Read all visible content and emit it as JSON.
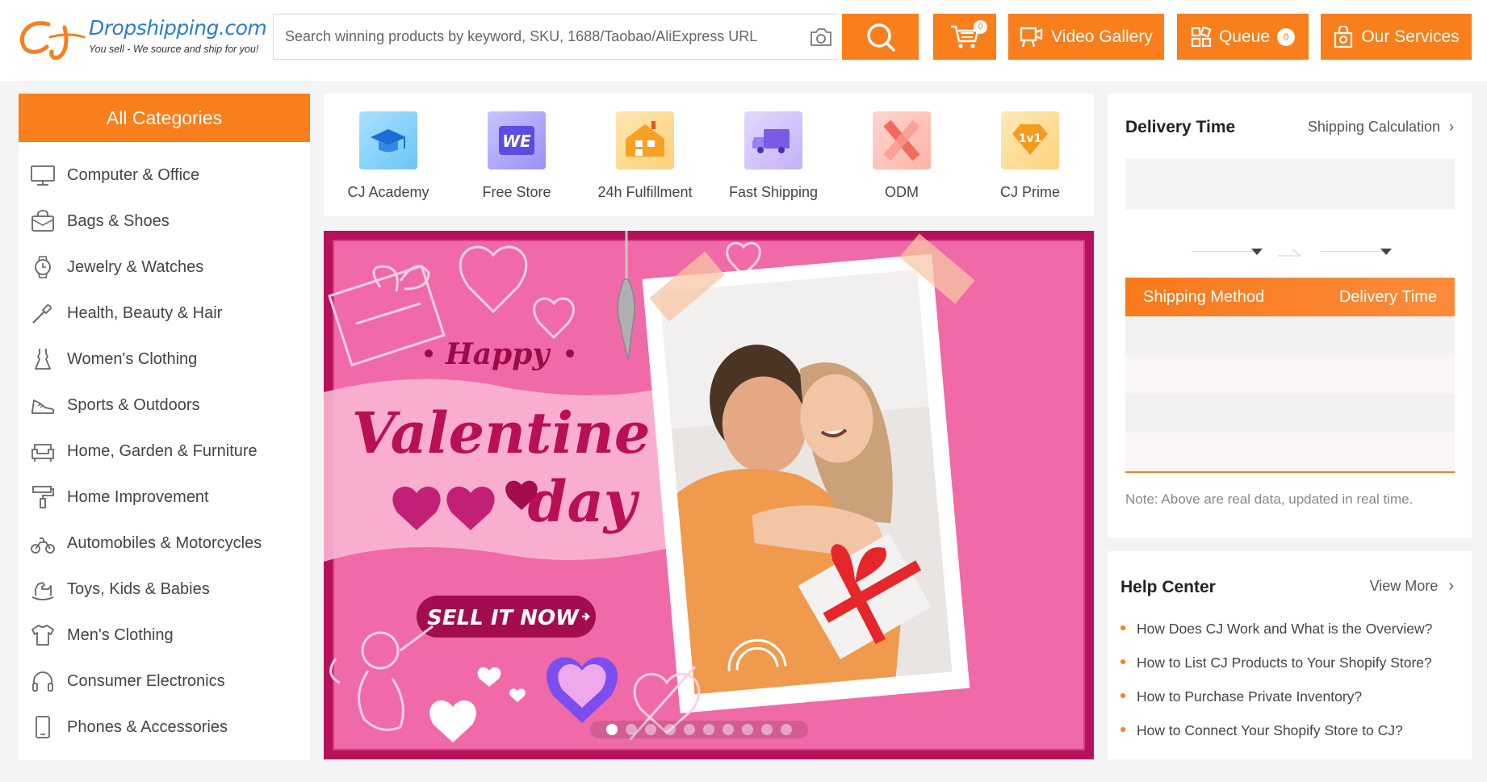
{
  "header": {
    "logo_text": "Dropshipping.com",
    "logo_tagline": "You sell - We source and ship for you!",
    "search_placeholder": "Search winning products by keyword, SKU, 1688/Taobao/AliExpress URL",
    "cart_count": "0",
    "video_gallery_label": "Video Gallery",
    "queue_label": "Queue",
    "queue_count": "0",
    "our_services_label": "Our Services"
  },
  "categories": {
    "title": "All Categories",
    "items": [
      {
        "label": "Computer & Office",
        "icon": "monitor-icon"
      },
      {
        "label": "Bags & Shoes",
        "icon": "bag-icon"
      },
      {
        "label": "Jewelry & Watches",
        "icon": "watch-icon"
      },
      {
        "label": "Health, Beauty & Hair",
        "icon": "brush-icon"
      },
      {
        "label": "Women's Clothing",
        "icon": "dress-icon"
      },
      {
        "label": "Sports & Outdoors",
        "icon": "sneaker-icon"
      },
      {
        "label": "Home, Garden & Furniture",
        "icon": "sofa-icon"
      },
      {
        "label": "Home Improvement",
        "icon": "paint-roller-icon"
      },
      {
        "label": "Automobiles & Motorcycles",
        "icon": "motorcycle-icon"
      },
      {
        "label": "Toys, Kids & Babies",
        "icon": "rocking-horse-icon"
      },
      {
        "label": "Men's Clothing",
        "icon": "tshirt-icon"
      },
      {
        "label": "Consumer Electronics",
        "icon": "headphones-icon"
      },
      {
        "label": "Phones & Accessories",
        "icon": "phone-icon"
      }
    ]
  },
  "quick_links": [
    {
      "label": "CJ Academy",
      "icon": "graduation-cap-icon",
      "color": "#3aa0e8"
    },
    {
      "label": "Free Store",
      "icon": "we-store-icon",
      "color": "#5a4de0"
    },
    {
      "label": "24h Fulfillment",
      "icon": "warehouse-icon",
      "color": "#f8a023"
    },
    {
      "label": "Fast Shipping",
      "icon": "truck-icon",
      "color": "#7a5be6"
    },
    {
      "label": "ODM",
      "icon": "ruler-pencil-icon",
      "color": "#f26a5c"
    },
    {
      "label": "CJ Prime",
      "icon": "diamond-1v1-icon",
      "color": "#f59b1f"
    }
  ],
  "banner": {
    "happy": "Happy",
    "valentines": "Valentine's",
    "day": "day",
    "cta": "SELL IT NOW",
    "slide_count": 10,
    "active_slide": 0
  },
  "delivery": {
    "title": "Delivery Time",
    "calc_link": "Shipping Calculation",
    "col_method": "Shipping Method",
    "col_time": "Delivery Time",
    "note": "Note: Above are real data, updated in real time."
  },
  "help": {
    "title": "Help Center",
    "more": "View More",
    "items": [
      "How Does CJ Work and What is the Overview?",
      "How to List CJ Products to Your Shopify Store?",
      "How to Purchase Private Inventory?",
      "How to Connect Your Shopify Store to CJ?"
    ]
  },
  "colors": {
    "accent": "#f97e1c",
    "logo_blue": "#2b7bd6",
    "banner_pink": "#f06aa8",
    "banner_frame": "#b8115a"
  }
}
